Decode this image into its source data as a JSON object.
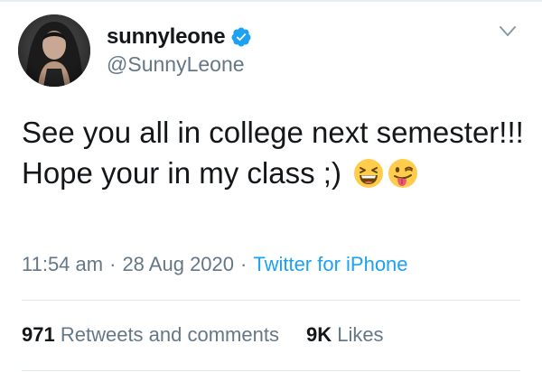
{
  "header": {
    "display_name": "sunnyleone",
    "handle": "@SunnyLeone",
    "avatar_icon": "profile-photo",
    "verified_icon": "verified-badge-icon",
    "menu_icon": "chevron-down-icon"
  },
  "tweet": {
    "text": "See you all in college next semester!!! Hope your in my class ;)",
    "emojis": [
      "grinning-squinting-face-emoji",
      "winking-face-with-tongue-emoji"
    ]
  },
  "meta": {
    "time": "11:54 am",
    "separator": "·",
    "date": "28 Aug 2020",
    "source": "Twitter for iPhone"
  },
  "stats": {
    "retweets_count": "971",
    "retweets_label": "Retweets and comments",
    "likes_count": "9K",
    "likes_label": "Likes"
  },
  "colors": {
    "text": "#14171a",
    "secondary": "#657786",
    "accent": "#1da1f2",
    "divider": "#e1e8ed"
  }
}
